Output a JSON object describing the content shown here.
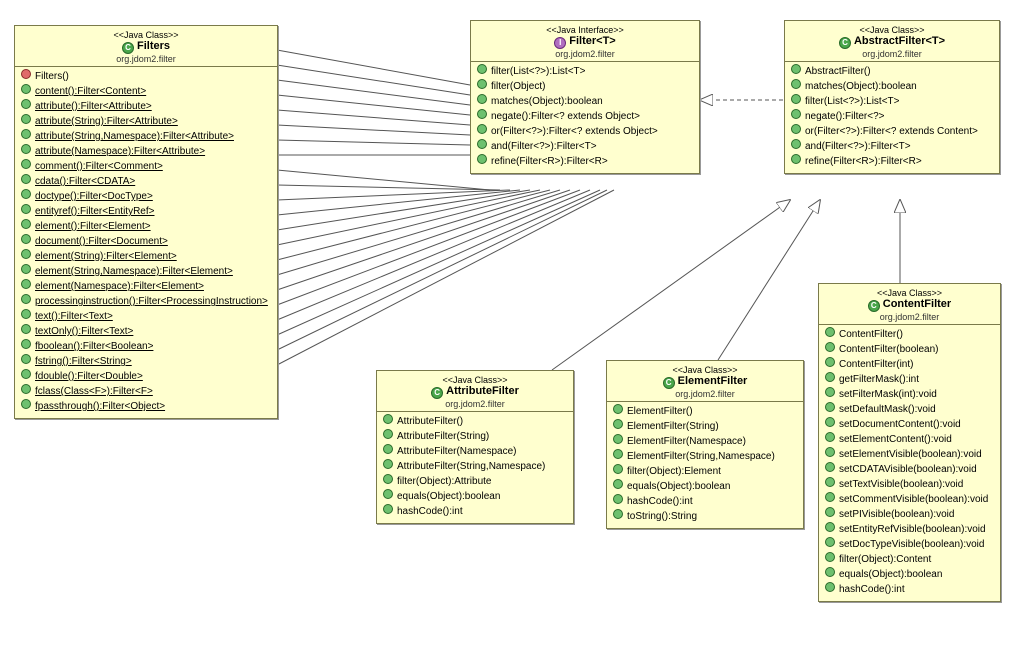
{
  "labels": {
    "java_class": "<<Java Class>>",
    "java_interface": "<<Java Interface>>",
    "pkg": "org.jdom2.filter"
  },
  "filters": {
    "title": "Filters",
    "members": [
      {
        "t": "Filters()",
        "v": "red"
      },
      {
        "t": "content():Filter<Content>",
        "u": 1
      },
      {
        "t": "attribute():Filter<Attribute>",
        "u": 1
      },
      {
        "t": "attribute(String):Filter<Attribute>",
        "u": 1
      },
      {
        "t": "attribute(String,Namespace):Filter<Attribute>",
        "u": 1
      },
      {
        "t": "attribute(Namespace):Filter<Attribute>",
        "u": 1
      },
      {
        "t": "comment():Filter<Comment>",
        "u": 1
      },
      {
        "t": "cdata():Filter<CDATA>",
        "u": 1
      },
      {
        "t": "doctype():Filter<DocType>",
        "u": 1
      },
      {
        "t": "entityref():Filter<EntityRef>",
        "u": 1
      },
      {
        "t": "element():Filter<Element>",
        "u": 1
      },
      {
        "t": "document():Filter<Document>",
        "u": 1
      },
      {
        "t": "element(String):Filter<Element>",
        "u": 1
      },
      {
        "t": "element(String,Namespace):Filter<Element>",
        "u": 1
      },
      {
        "t": "element(Namespace):Filter<Element>",
        "u": 1
      },
      {
        "t": "processinginstruction():Filter<ProcessingInstruction>",
        "u": 1
      },
      {
        "t": "text():Filter<Text>",
        "u": 1
      },
      {
        "t": "textOnly():Filter<Text>",
        "u": 1
      },
      {
        "t": "fboolean():Filter<Boolean>",
        "u": 1
      },
      {
        "t": "fstring():Filter<String>",
        "u": 1
      },
      {
        "t": "fdouble():Filter<Double>",
        "u": 1
      },
      {
        "t": "fclass(Class<F>):Filter<F>",
        "u": 1
      },
      {
        "t": "fpassthrough():Filter<Object>",
        "u": 1
      }
    ]
  },
  "filter": {
    "title": "Filter<T>",
    "members": [
      {
        "t": "filter(List<?>):List<T>"
      },
      {
        "t": "filter(Object)"
      },
      {
        "t": "matches(Object):boolean"
      },
      {
        "t": "negate():Filter<? extends Object>"
      },
      {
        "t": "or(Filter<?>):Filter<? extends Object>"
      },
      {
        "t": "and(Filter<?>):Filter<T>"
      },
      {
        "t": "refine(Filter<R>):Filter<R>"
      }
    ]
  },
  "abstract": {
    "title": "AbstractFilter<T>",
    "members": [
      {
        "t": "AbstractFilter()"
      },
      {
        "t": "matches(Object):boolean"
      },
      {
        "t": "filter(List<?>):List<T>"
      },
      {
        "t": "negate():Filter<?>"
      },
      {
        "t": "or(Filter<?>):Filter<? extends Content>"
      },
      {
        "t": "and(Filter<?>):Filter<T>"
      },
      {
        "t": "refine(Filter<R>):Filter<R>"
      }
    ]
  },
  "attrfilter": {
    "title": "AttributeFilter",
    "members": [
      {
        "t": "AttributeFilter()"
      },
      {
        "t": "AttributeFilter(String)"
      },
      {
        "t": "AttributeFilter(Namespace)"
      },
      {
        "t": "AttributeFilter(String,Namespace)"
      },
      {
        "t": "filter(Object):Attribute"
      },
      {
        "t": "equals(Object):boolean"
      },
      {
        "t": "hashCode():int"
      }
    ]
  },
  "elemfilter": {
    "title": "ElementFilter",
    "members": [
      {
        "t": "ElementFilter()"
      },
      {
        "t": "ElementFilter(String)"
      },
      {
        "t": "ElementFilter(Namespace)"
      },
      {
        "t": "ElementFilter(String,Namespace)"
      },
      {
        "t": "filter(Object):Element"
      },
      {
        "t": "equals(Object):boolean"
      },
      {
        "t": "hashCode():int"
      },
      {
        "t": "toString():String"
      }
    ]
  },
  "contentfilter": {
    "title": "ContentFilter",
    "members": [
      {
        "t": "ContentFilter()"
      },
      {
        "t": "ContentFilter(boolean)"
      },
      {
        "t": "ContentFilter(int)"
      },
      {
        "t": "getFilterMask():int"
      },
      {
        "t": "setFilterMask(int):void"
      },
      {
        "t": "setDefaultMask():void"
      },
      {
        "t": "setDocumentContent():void"
      },
      {
        "t": "setElementContent():void"
      },
      {
        "t": "setElementVisible(boolean):void"
      },
      {
        "t": "setCDATAVisible(boolean):void"
      },
      {
        "t": "setTextVisible(boolean):void"
      },
      {
        "t": "setCommentVisible(boolean):void"
      },
      {
        "t": "setPIVisible(boolean):void"
      },
      {
        "t": "setEntityRefVisible(boolean):void"
      },
      {
        "t": "setDocTypeVisible(boolean):void"
      },
      {
        "t": "filter(Object):Content"
      },
      {
        "t": "equals(Object):boolean"
      },
      {
        "t": "hashCode():int"
      }
    ]
  }
}
